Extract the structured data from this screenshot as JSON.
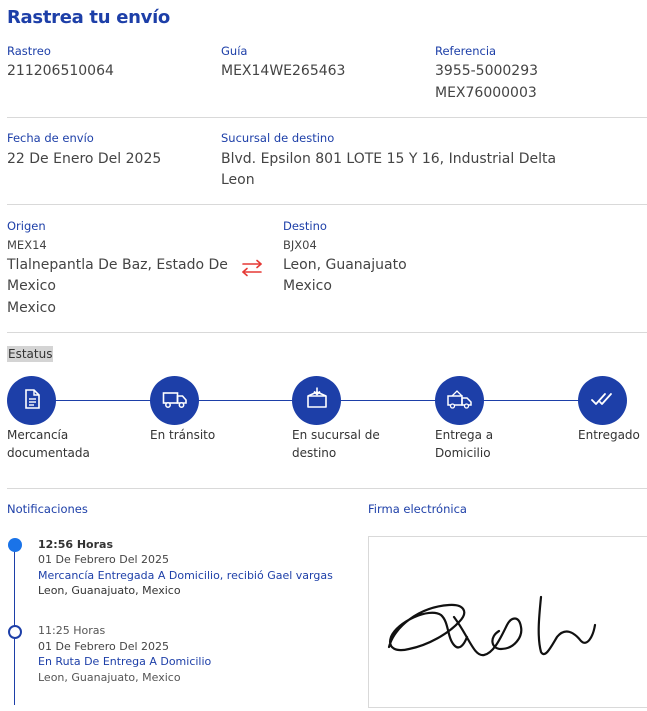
{
  "page_title": "Rastrea tu envío",
  "shipment": {
    "rastreo_label": "Rastreo",
    "rastreo_value": "211206510064",
    "guia_label": "Guía",
    "guia_value": "MEX14WE265463",
    "referencia_label": "Referencia",
    "referencia_value_1": "3955-5000293",
    "referencia_value_2": "MEX76000003",
    "fecha_label": "Fecha de envío",
    "fecha_value": "22 De Enero Del 2025",
    "sucursal_label": "Sucursal de destino",
    "sucursal_value_1": "Blvd. Epsilon 801 LOTE 15 Y 16, Industrial Delta",
    "sucursal_value_2": "Leon"
  },
  "origin": {
    "label": "Origen",
    "code": "MEX14",
    "city_1": "Tlalnepantla De Baz, Estado De",
    "city_2": "Mexico",
    "country": "Mexico"
  },
  "destination": {
    "label": "Destino",
    "code": "BJX04",
    "city": "Leon, Guanajuato",
    "country": "Mexico"
  },
  "status": {
    "label": "Estatus",
    "steps": [
      {
        "line1": "Mercancía",
        "line2": "documentada",
        "icon": "document-icon"
      },
      {
        "line1": "En tránsito",
        "line2": "",
        "icon": "truck-icon"
      },
      {
        "line1": "En sucursal de",
        "line2": "destino",
        "icon": "package-icon"
      },
      {
        "line1": "Entrega a",
        "line2": "Domicilio",
        "icon": "delivery-van-icon"
      },
      {
        "line1": "Entregado",
        "line2": "",
        "icon": "double-check-icon"
      }
    ]
  },
  "notifications": {
    "label": "Notificaciones",
    "events": [
      {
        "time": "12:56 Horas",
        "date": "01 De Febrero Del 2025",
        "desc": "Mercancía Entregada A Domicilio, recibió Gael vargas",
        "place": "Leon, Guanajuato, Mexico"
      },
      {
        "time": "11:25 Horas",
        "date": "01 De Febrero Del 2025",
        "desc": "En Ruta De Entrega A Domicilio",
        "place": "Leon, Guanajuato, Mexico"
      }
    ]
  },
  "signature": {
    "label": "Firma electrónica"
  },
  "colors": {
    "primary": "#1d3fa8",
    "accent_dot": "#1a73e8",
    "swap_arrows": "#e53935"
  }
}
